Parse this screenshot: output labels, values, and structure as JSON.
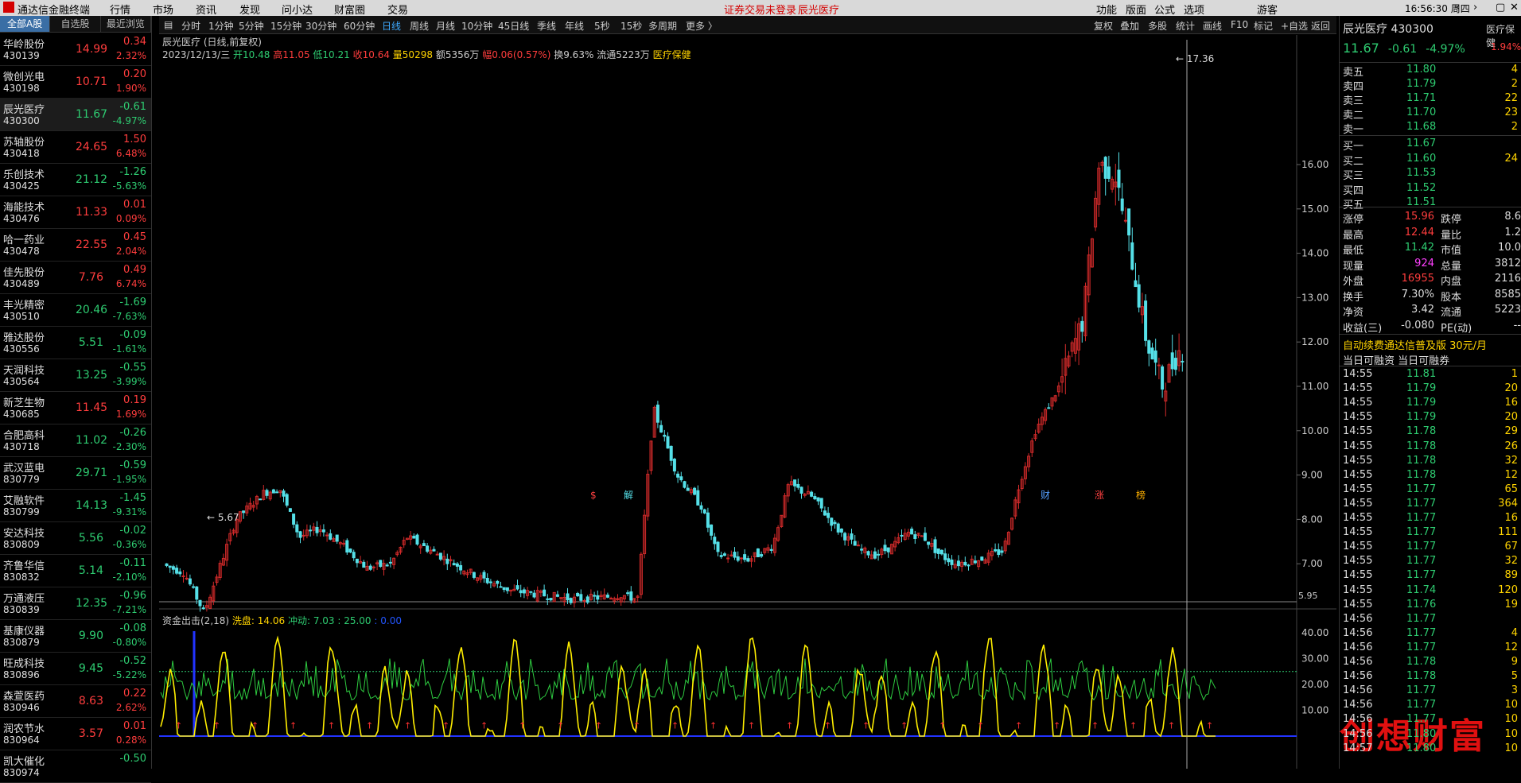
{
  "menubar": {
    "app_title": "通达信金融终端",
    "menus": [
      "行情",
      "市场",
      "资讯",
      "发现",
      "问小达",
      "财富圈",
      "交易"
    ],
    "notice": "证券交易未登录",
    "stock_name": "辰光医疗",
    "right_items": [
      "游客",
      "功能",
      "版面",
      "公式",
      "选项"
    ],
    "clock": "16:56:30 周四"
  },
  "left_tabs": [
    "全部A股",
    "自选股",
    "最近浏览"
  ],
  "stocks": [
    {
      "name": "华岭股份",
      "code": "430139",
      "price": "14.99",
      "change": "0.34",
      "pct": "2.32%",
      "dir": "up"
    },
    {
      "name": "微创光电",
      "code": "430198",
      "price": "10.71",
      "change": "0.20",
      "pct": "1.90%",
      "dir": "up"
    },
    {
      "name": "辰光医疗",
      "code": "430300",
      "price": "11.67",
      "change": "-0.61",
      "pct": "-4.97%",
      "dir": "dn"
    },
    {
      "name": "苏轴股份",
      "code": "430418",
      "price": "24.65",
      "change": "1.50",
      "pct": "6.48%",
      "dir": "up"
    },
    {
      "name": "乐创技术",
      "code": "430425",
      "price": "21.12",
      "change": "-1.26",
      "pct": "-5.63%",
      "dir": "dn"
    },
    {
      "name": "海能技术",
      "code": "430476",
      "price": "11.33",
      "change": "0.01",
      "pct": "0.09%",
      "dir": "up"
    },
    {
      "name": "哈一药业",
      "code": "430478",
      "price": "22.55",
      "change": "0.45",
      "pct": "2.04%",
      "dir": "up"
    },
    {
      "name": "佳先股份",
      "code": "430489",
      "price": "7.76",
      "change": "0.49",
      "pct": "6.74%",
      "dir": "up"
    },
    {
      "name": "丰光精密",
      "code": "430510",
      "price": "20.46",
      "change": "-1.69",
      "pct": "-7.63%",
      "dir": "dn"
    },
    {
      "name": "雅达股份",
      "code": "430556",
      "price": "5.51",
      "change": "-0.09",
      "pct": "-1.61%",
      "dir": "dn"
    },
    {
      "name": "天润科技",
      "code": "430564",
      "price": "13.25",
      "change": "-0.55",
      "pct": "-3.99%",
      "dir": "dn"
    },
    {
      "name": "新芝生物",
      "code": "430685",
      "price": "11.45",
      "change": "0.19",
      "pct": "1.69%",
      "dir": "up"
    },
    {
      "name": "合肥高科",
      "code": "430718",
      "price": "11.02",
      "change": "-0.26",
      "pct": "-2.30%",
      "dir": "dn"
    },
    {
      "name": "武汉蓝电",
      "code": "830779",
      "price": "29.71",
      "change": "-0.59",
      "pct": "-1.95%",
      "dir": "dn"
    },
    {
      "name": "艾融软件",
      "code": "830799",
      "price": "14.13",
      "change": "-1.45",
      "pct": "-9.31%",
      "dir": "dn"
    },
    {
      "name": "安达科技",
      "code": "830809",
      "price": "5.56",
      "change": "-0.02",
      "pct": "-0.36%",
      "dir": "dn"
    },
    {
      "name": "齐鲁华信",
      "code": "830832",
      "price": "5.14",
      "change": "-0.11",
      "pct": "-2.10%",
      "dir": "dn"
    },
    {
      "name": "万通液压",
      "code": "830839",
      "price": "12.35",
      "change": "-0.96",
      "pct": "-7.21%",
      "dir": "dn"
    },
    {
      "name": "基康仪器",
      "code": "830879",
      "price": "9.90",
      "change": "-0.08",
      "pct": "-0.80%",
      "dir": "dn"
    },
    {
      "name": "旺成科技",
      "code": "830896",
      "price": "9.45",
      "change": "-0.52",
      "pct": "-5.22%",
      "dir": "dn"
    },
    {
      "name": "森萱医药",
      "code": "830946",
      "price": "8.63",
      "change": "0.22",
      "pct": "2.62%",
      "dir": "up"
    },
    {
      "name": "润农节水",
      "code": "830964",
      "price": "3.57",
      "change": "0.01",
      "pct": "0.28%",
      "dir": "up"
    },
    {
      "name": "凯大催化",
      "code": "830974",
      "price": "",
      "change": "-0.50",
      "pct": "",
      "dir": "dn"
    }
  ],
  "toolbar": {
    "periods": [
      "分时",
      "1分钟",
      "5分钟",
      "15分钟",
      "30分钟",
      "60分钟",
      "日线",
      "周线",
      "月线",
      "10分钟",
      "45日线",
      "季线",
      "年线",
      "5秒",
      "15秒",
      "多周期",
      "更多 〉"
    ],
    "active_period": "日线",
    "tools": [
      "复权",
      "叠加",
      "多股",
      "统计",
      "画线",
      "F10",
      "标记",
      "+自选",
      "返回"
    ]
  },
  "chart_header": {
    "title": "辰光医疗 (日线,前复权)",
    "date": "2023/12/13/三",
    "open": "开10.48",
    "high": "高11.05",
    "low": "低10.21",
    "close": "收10.64",
    "volume": "量50298",
    "amount": "额5356万",
    "amplitude": "幅0.06(0.57%)",
    "turnover": "换9.63%",
    "float": "流通5223万",
    "sector": "医疗保健"
  },
  "price_axis": [
    "16.00",
    "15.00",
    "14.00",
    "13.00",
    "12.00",
    "11.00",
    "10.00",
    "9.00",
    "8.00",
    "7.00",
    "5.95"
  ],
  "annotations": {
    "max": "17.36",
    "min": "5.67"
  },
  "event_marks": [
    "$",
    "解",
    "财",
    "涨",
    "榜"
  ],
  "indicator": {
    "title": "资金出击(2,18)",
    "wash": "洗盘: 14.06",
    "impulse": "冲动: 7.03 : 25.00",
    "extra": ": 0.00",
    "axis": [
      "40.00",
      "30.00",
      "20.00",
      "10.00"
    ],
    "threshold": 25
  },
  "quote": {
    "name": "辰光医疗",
    "code": "430300",
    "price": "11.67",
    "change": "-0.61",
    "pct": "-4.97%",
    "sector": "医疗保健",
    "sector_pct": "1.94%",
    "asks": [
      {
        "label": "卖五",
        "price": "11.80",
        "vol": "4"
      },
      {
        "label": "卖四",
        "price": "11.79",
        "vol": "2"
      },
      {
        "label": "卖三",
        "price": "11.71",
        "vol": "22"
      },
      {
        "label": "卖二",
        "price": "11.70",
        "vol": "23"
      },
      {
        "label": "卖一",
        "price": "11.68",
        "vol": "2"
      }
    ],
    "bids": [
      {
        "label": "买一",
        "price": "11.67",
        "vol": ""
      },
      {
        "label": "买二",
        "price": "11.60",
        "vol": "24"
      },
      {
        "label": "买三",
        "price": "11.53",
        "vol": ""
      },
      {
        "label": "买四",
        "price": "11.52",
        "vol": ""
      },
      {
        "label": "买五",
        "price": "11.51",
        "vol": ""
      }
    ],
    "stats": [
      {
        "l1": "涨停",
        "v1": "15.96",
        "c1": "up",
        "l2": "跌停",
        "v2": "8.6"
      },
      {
        "l1": "最高",
        "v1": "12.44",
        "c1": "up",
        "l2": "量比",
        "v2": "1.2"
      },
      {
        "l1": "最低",
        "v1": "11.42",
        "c1": "dn",
        "l2": "市值",
        "v2": "10.0"
      },
      {
        "l1": "现量",
        "v1": "924",
        "c1": "mag",
        "l2": "总量",
        "v2": "3812"
      },
      {
        "l1": "外盘",
        "v1": "16955",
        "c1": "up",
        "l2": "内盘",
        "v2": "2116"
      },
      {
        "l1": "换手",
        "v1": "7.30%",
        "c1": "wh",
        "l2": "股本",
        "v2": "8585"
      },
      {
        "l1": "净资",
        "v1": "3.42",
        "c1": "wh",
        "l2": "流通",
        "v2": "5223"
      },
      {
        "l1": "收益(三)",
        "v1": "-0.080",
        "c1": "wh",
        "l2": "PE(动)",
        "v2": "--"
      }
    ],
    "promo": "自动续费通达信普及版  30元/月",
    "margin": "当日可融资  当日可融券",
    "ticks": [
      {
        "t": "14:55",
        "p": "11.81",
        "v": "1"
      },
      {
        "t": "14:55",
        "p": "11.79",
        "v": "20"
      },
      {
        "t": "14:55",
        "p": "11.79",
        "v": "16"
      },
      {
        "t": "14:55",
        "p": "11.79",
        "v": "20"
      },
      {
        "t": "14:55",
        "p": "11.78",
        "v": "29"
      },
      {
        "t": "14:55",
        "p": "11.78",
        "v": "26"
      },
      {
        "t": "14:55",
        "p": "11.78",
        "v": "32"
      },
      {
        "t": "14:55",
        "p": "11.78",
        "v": "12"
      },
      {
        "t": "14:55",
        "p": "11.77",
        "v": "65"
      },
      {
        "t": "14:55",
        "p": "11.77",
        "v": "364"
      },
      {
        "t": "14:55",
        "p": "11.77",
        "v": "16"
      },
      {
        "t": "14:55",
        "p": "11.77",
        "v": "111"
      },
      {
        "t": "14:55",
        "p": "11.77",
        "v": "67"
      },
      {
        "t": "14:55",
        "p": "11.77",
        "v": "32"
      },
      {
        "t": "14:55",
        "p": "11.77",
        "v": "89"
      },
      {
        "t": "14:55",
        "p": "11.74",
        "v": "120"
      },
      {
        "t": "14:55",
        "p": "11.76",
        "v": "19"
      },
      {
        "t": "14:56",
        "p": "11.77",
        "v": ""
      },
      {
        "t": "14:56",
        "p": "11.77",
        "v": "4"
      },
      {
        "t": "14:56",
        "p": "11.77",
        "v": "12"
      },
      {
        "t": "14:56",
        "p": "11.78",
        "v": "9"
      },
      {
        "t": "14:56",
        "p": "11.78",
        "v": "5"
      },
      {
        "t": "14:56",
        "p": "11.77",
        "v": "3"
      },
      {
        "t": "14:56",
        "p": "11.77",
        "v": "10"
      },
      {
        "t": "14:56",
        "p": "11.77",
        "v": "10"
      },
      {
        "t": "14:56",
        "p": "11.80",
        "v": "10"
      },
      {
        "t": "14:57",
        "p": "11.80",
        "v": "10"
      }
    ]
  },
  "watermark": "创想财富",
  "chart_data": {
    "type": "candlestick",
    "title": "辰光医疗 (日线,前复权)",
    "y_axis_ticks": [
      7,
      8,
      9,
      10,
      11,
      12,
      13,
      14,
      15,
      16
    ],
    "annotated_max": 17.36,
    "annotated_min": 5.67
  }
}
